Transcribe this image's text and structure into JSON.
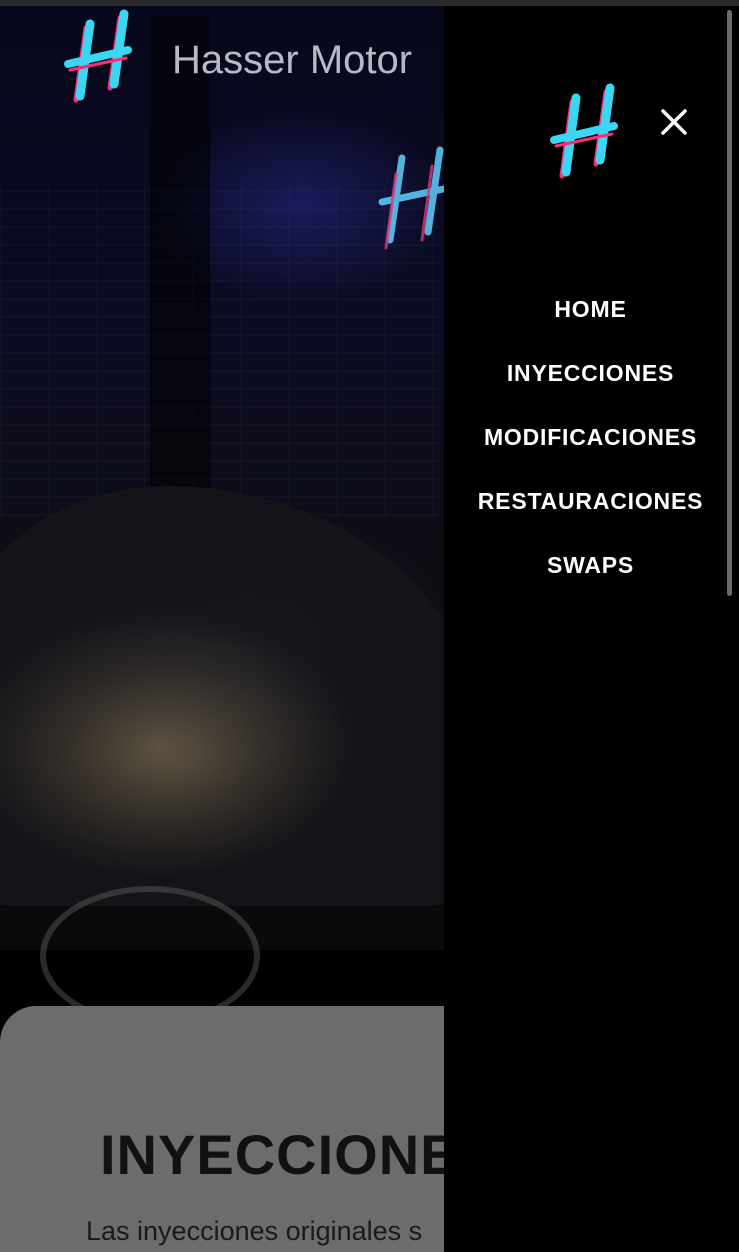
{
  "header": {
    "title": "Hasser Motor",
    "logo_icon": "hasser-h-logo-icon"
  },
  "hero": {
    "neon_sign_icon": "neon-h-sign-icon"
  },
  "content": {
    "section_title": "INYECCIONE",
    "section_text": "Las inyecciones originales s"
  },
  "drawer": {
    "logo_icon": "hasser-h-logo-icon",
    "close_icon": "close-icon",
    "nav": [
      {
        "label": "HOME"
      },
      {
        "label": "INYECCIONES"
      },
      {
        "label": "MODIFICACIONES"
      },
      {
        "label": "RESTAURACIONES"
      },
      {
        "label": "SWAPS"
      }
    ]
  },
  "colors": {
    "logo_cyan": "#3ad6f2",
    "logo_pink": "#ff2a78",
    "drawer_bg": "#000000",
    "nav_text": "#ffffff",
    "card_bg": "#6c6c6c"
  }
}
